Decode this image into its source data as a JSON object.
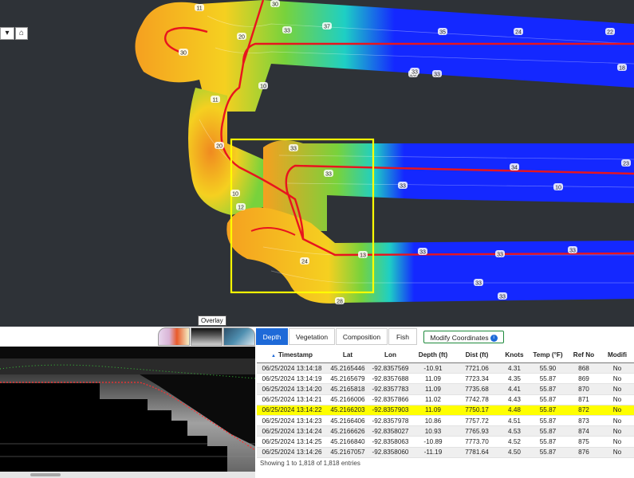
{
  "map": {
    "basemap_dropdown": "▾",
    "home_icon": "home-icon",
    "contour_labels": [
      "11",
      "20",
      "30",
      "30",
      "33",
      "37",
      "33",
      "26",
      "11",
      "10",
      "20",
      "10",
      "12",
      "33",
      "33",
      "33",
      "34",
      "10",
      "13",
      "24",
      "28",
      "33",
      "33",
      "33",
      "33",
      "35",
      "24",
      "33",
      "22",
      "18",
      "23",
      "33"
    ],
    "colors": {
      "shallow": "#f5a020",
      "mid": "#78d23c",
      "deep": "#1428ff",
      "track": "#e8141e",
      "selection": "#ffff00"
    }
  },
  "thumbnails": {
    "overlay_tooltip": "Overlay"
  },
  "tabs": [
    {
      "label": "Depth",
      "active": true
    },
    {
      "label": "Vegetation",
      "active": false
    },
    {
      "label": "Composition",
      "active": false
    },
    {
      "label": "Fish",
      "active": false
    }
  ],
  "modify_button": {
    "label": "Modify Coordinates",
    "badge": "i"
  },
  "table": {
    "sort_icon": "▲",
    "columns": [
      "Timestamp",
      "Lat",
      "Lon",
      "Depth (ft)",
      "Dist (ft)",
      "Knots",
      "Temp (°F)",
      "Ref No",
      "Modifi"
    ],
    "rows": [
      [
        "06/25/2024 13:14:18",
        "45.2165446",
        "-92.8357569",
        "-10.91",
        "7721.06",
        "4.31",
        "55.90",
        "868",
        "No"
      ],
      [
        "06/25/2024 13:14:19",
        "45.2165679",
        "-92.8357688",
        "11.09",
        "7723.34",
        "4.35",
        "55.87",
        "869",
        "No"
      ],
      [
        "06/25/2024 13:14:20",
        "45.2165818",
        "-92.8357783",
        "11.09",
        "7735.68",
        "4.41",
        "55.87",
        "870",
        "No"
      ],
      [
        "06/25/2024 13:14:21",
        "45.2166006",
        "-92.8357866",
        "11.02",
        "7742.78",
        "4.43",
        "55.87",
        "871",
        "No"
      ],
      [
        "06/25/2024 13:14:22",
        "45.2166203",
        "-92.8357903",
        "11.09",
        "7750.17",
        "4.48",
        "55.87",
        "872",
        "No"
      ],
      [
        "06/25/2024 13:14:23",
        "45.2166406",
        "-92.8357978",
        "10.86",
        "7757.72",
        "4.51",
        "55.87",
        "873",
        "No"
      ],
      [
        "06/25/2024 13:14:24",
        "45.2166626",
        "-92.8358027",
        "10.93",
        "7765.93",
        "4.53",
        "55.87",
        "874",
        "No"
      ],
      [
        "06/25/2024 13:14:25",
        "45.2166840",
        "-92.8358063",
        "-10.89",
        "7773.70",
        "4.52",
        "55.87",
        "875",
        "No"
      ],
      [
        "06/25/2024 13:14:26",
        "45.2167057",
        "-92.8358060",
        "-11.19",
        "7781.64",
        "4.50",
        "55.87",
        "876",
        "No"
      ]
    ],
    "selected_row": 4,
    "footer": "Showing 1 to 1,818 of 1,818 entries"
  }
}
